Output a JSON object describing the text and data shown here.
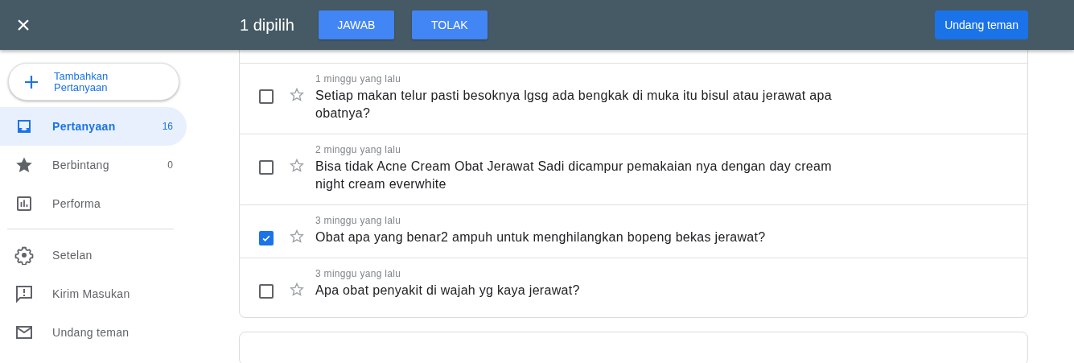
{
  "header": {
    "close_icon": "×",
    "selection_count": "1 dipilih",
    "actions": [
      "JAWAB",
      "TOLAK"
    ],
    "invite_button": "Undang teman"
  },
  "sidebar": {
    "add_button": "Tambahkan Pertanyaan",
    "items": [
      {
        "kind": "inbox",
        "label": "Pertanyaan",
        "count": "16",
        "selected": true
      },
      {
        "kind": "star",
        "label": "Berbintang",
        "count": "0",
        "selected": false
      },
      {
        "kind": "chart",
        "label": "Performa",
        "selected": false
      }
    ],
    "secondary_items": [
      {
        "kind": "gear",
        "label": "Setelan"
      },
      {
        "kind": "feedback",
        "label": "Kirim Masukan"
      },
      {
        "kind": "mail",
        "label": "Undang teman"
      }
    ]
  },
  "questions": [
    {
      "time": "1 minggu yang lalu",
      "text": "Setiap makan telur pasti besoknya lgsg ada bengkak di muka itu bisul atau jerawat apa obatnya?",
      "checked": false,
      "starred": false
    },
    {
      "time": "2 minggu yang lalu",
      "text": "Bisa tidak Acne Cream Obat Jerawat Sadi dicampur pemakaian nya dengan day cream night cream everwhite",
      "checked": false,
      "starred": false
    },
    {
      "time": "3 minggu yang lalu",
      "text": "Obat apa yang benar2 ampuh untuk menghilangkan bopeng bekas jerawat?",
      "checked": true,
      "starred": false
    },
    {
      "time": "3 minggu yang lalu",
      "text": "Apa obat penyakit di wajah yg kaya jerawat?",
      "checked": false,
      "starred": false
    }
  ]
}
